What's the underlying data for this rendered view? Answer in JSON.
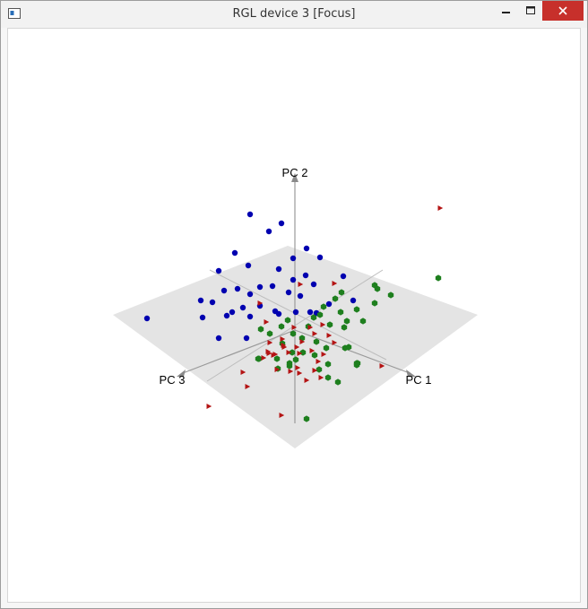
{
  "window": {
    "title": "RGL device 3 [Focus]",
    "controls": [
      "minimize-icon",
      "maximize-icon",
      "close-icon"
    ],
    "close_color": "#c7302b"
  },
  "scene": {
    "axis_labels": {
      "pc1": "PC 1",
      "pc2": "PC 2",
      "pc3": "PC 3"
    },
    "plane_color": "#e4e4e4",
    "axis_color": "#9a9a9a",
    "group_colors": [
      "#0000b0",
      "#1e7f1e",
      "#b41414"
    ],
    "group_markers": [
      "sphere",
      "cube",
      "tetrahedron"
    ]
  }
}
